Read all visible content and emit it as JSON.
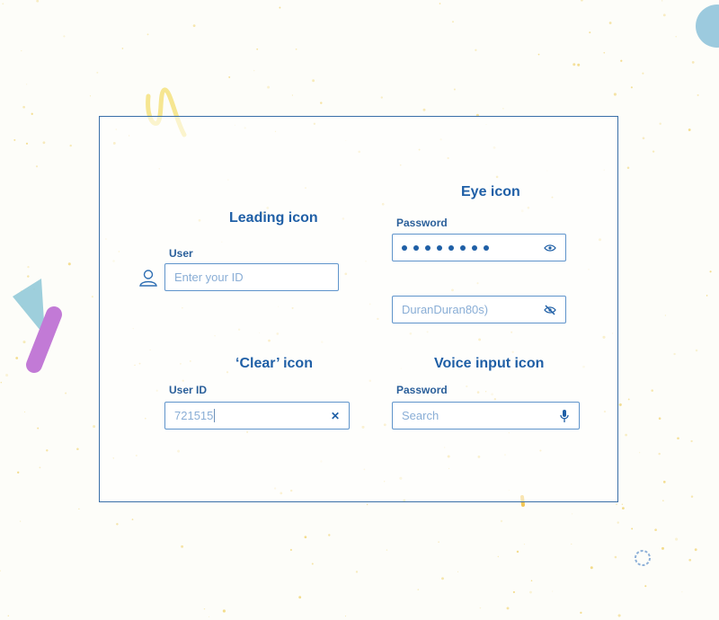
{
  "sections": {
    "leading": {
      "heading": "Leading icon",
      "label": "User",
      "placeholder": "Enter your ID",
      "icon": "user-icon"
    },
    "eye": {
      "heading": "Eye icon",
      "label": "Password",
      "masked_length": 8,
      "visible_value": "DuranDuran80s)",
      "icons": [
        "eye-icon",
        "eye-off-icon"
      ]
    },
    "clear": {
      "heading": "‘Clear’ icon",
      "label": "User ID",
      "value": "721515",
      "icon": "clear-icon",
      "icon_glyph": "✕"
    },
    "voice": {
      "heading": "Voice input icon",
      "label": "Password",
      "placeholder": "Search",
      "icon": "microphone-icon"
    }
  },
  "colors": {
    "accent": "#1f5fa6",
    "border": "#5f94cb",
    "placeholder": "#8aaed6",
    "background": "#fdfdf9"
  }
}
